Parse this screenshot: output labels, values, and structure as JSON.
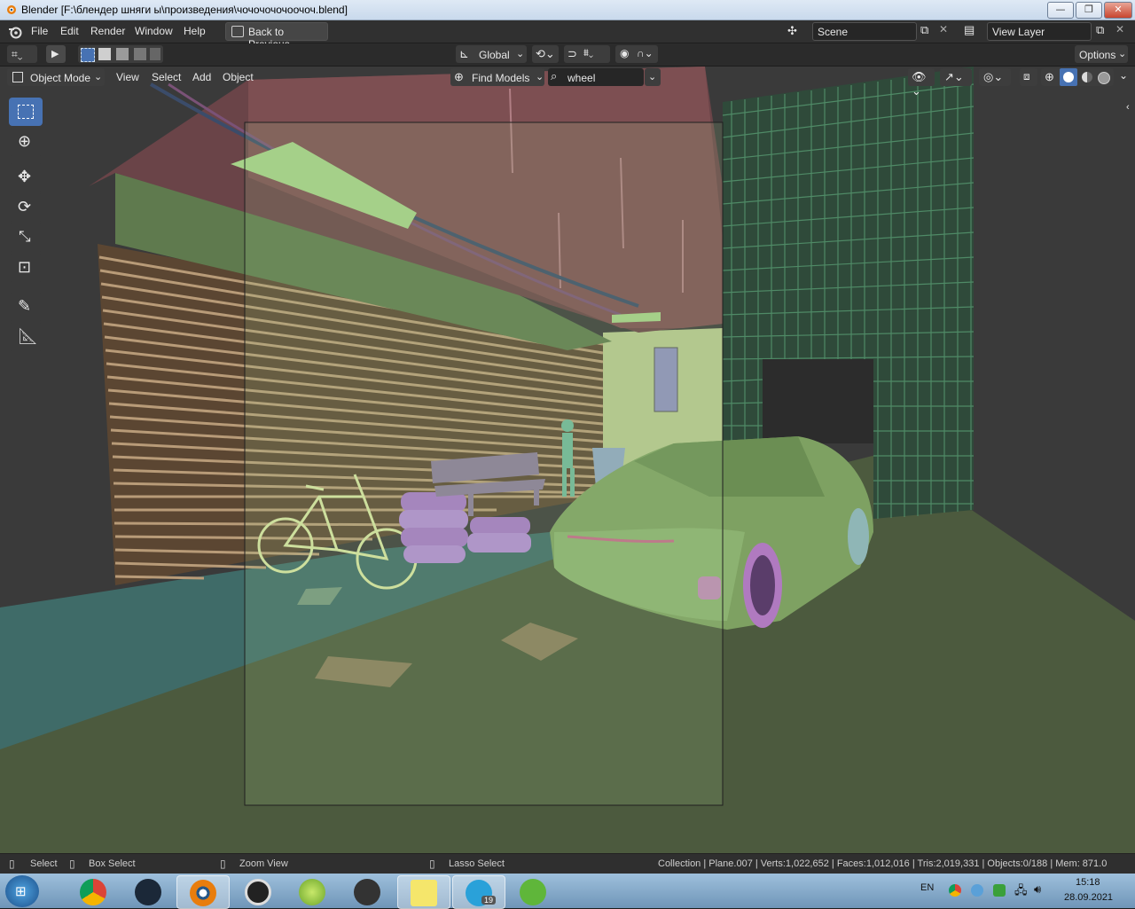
{
  "window": {
    "title": "Blender [F:\\блендер шняги ы\\произведения\\чочочочочоочоч.blend]",
    "min": "—",
    "max": "❐",
    "close": "✕"
  },
  "menubar": {
    "items": [
      "File",
      "Edit",
      "Render",
      "Window",
      "Help"
    ],
    "back_button": "Back to Previous",
    "scene": "Scene",
    "view_layer": "View Layer"
  },
  "toolheader": {
    "orientation": "Global",
    "options": "Options"
  },
  "viewheader": {
    "mode": "Object Mode",
    "menus": [
      "View",
      "Select",
      "Add",
      "Object"
    ],
    "asset_button": "Find Models",
    "search_value": "wheel"
  },
  "toolbar": {
    "tools": [
      "select-box",
      "cursor",
      "move",
      "rotate",
      "scale",
      "transform",
      "annotate",
      "measure"
    ],
    "active": "select-box"
  },
  "statusbar": {
    "select": "Select",
    "box_select": "Box Select",
    "zoom_view": "Zoom View",
    "lasso_select": "Lasso Select",
    "stats": "Collection | Plane.007 | Verts:1,022,652 | Faces:1,012,016 | Tris:2,019,331 | Objects:0/188 | Mem: 871.0"
  },
  "taskbar": {
    "apps": [
      "chrome",
      "steam",
      "blender",
      "pinnacle",
      "lime",
      "vivaldi",
      "sticky-notes",
      "telegram",
      "utorrent"
    ],
    "telegram_badge": "19",
    "lang": "EN",
    "time": "15:18",
    "date": "28.09.2021"
  },
  "colors": {
    "accent": "#4772b3",
    "header": "#303030",
    "viewport_bg": "#3b3b3b"
  }
}
